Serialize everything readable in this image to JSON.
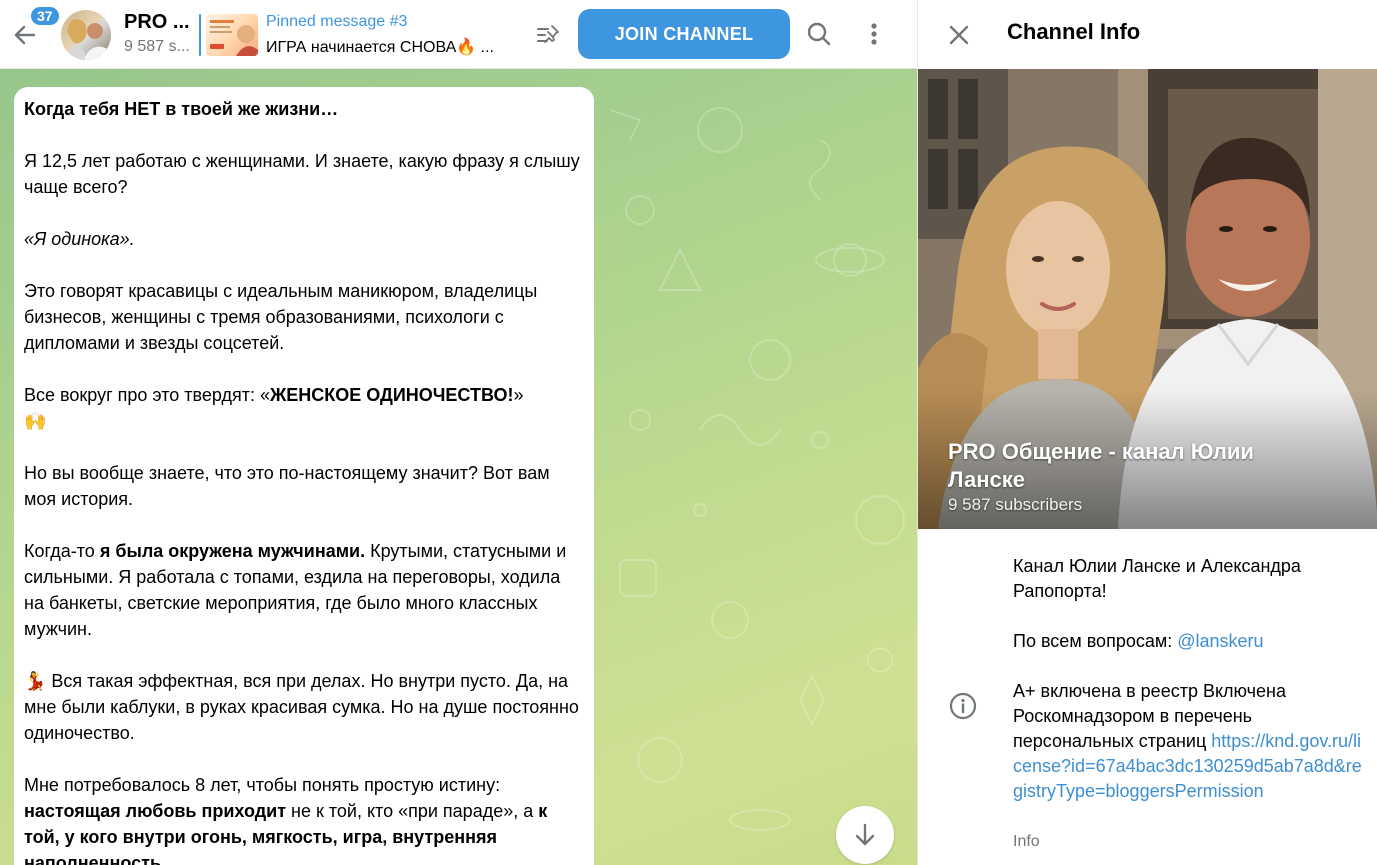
{
  "header": {
    "unread_count": "37",
    "channel_title_short": "PRO ...",
    "subscribers_short": "9 587 s...",
    "pinned_label": "Pinned message #3",
    "pinned_text": "ИГРА начинается СНОВА🔥 ...",
    "join_label": "JOIN CHANNEL"
  },
  "message": {
    "title": "Когда тебя НЕТ в твоей же жизни…",
    "p1": "Я 12,5 лет работаю с женщинами. И знаете, какую фразу я слышу чаще всего?",
    "p2": "«Я одинока».",
    "p3": "Это говорят красавицы с идеальным маникюром, владелицы бизнесов, женщины с тремя образованиями, психологи с дипломами и звезды соцсетей.",
    "p4_a": "Все вокруг про это твердят: «",
    "p4_b": "ЖЕНСКОЕ ОДИНОЧЕСТВО!",
    "p4_c": "»",
    "p4_emoji": "🙌",
    "p5": "Но вы вообще знаете, что это по-настоящему значит? Вот вам моя история.",
    "p6_a": "Когда-то ",
    "p6_b": "я была окружена мужчинами.",
    "p6_c": " Крутыми, статусными и сильными. Я работала с топами, ездила на переговоры, ходила на банкеты, светские мероприятия, где было много классных мужчин.",
    "p7_emoji": "💃",
    "p7": " Вся такая эффектная, вся при делах. Но внутри пусто. Да, на мне были каблуки, в руках красивая сумка. Но на душе постоянно одиночество.",
    "p8_a": "Мне потребовалось 8 лет, чтобы понять простую истину: ",
    "p8_b": "настоящая любовь приходит",
    "p8_c": " не к той, кто «при параде», а ",
    "p8_d": "к той, у кого внутри огонь, мягкость, игра, внутренняя наполненность."
  },
  "info_panel": {
    "title": "Channel Info",
    "channel_name": "PRO Общение - канал Юлии Ланске",
    "subscribers": "9 587 subscribers",
    "description_line1": "Канал Юлии Ланске и Александра Рапопорта!",
    "description_line2_prefix": "По всем вопросам: ",
    "description_line2_link": "@lanskeru",
    "registry_text": "А+ включена в реестр Включена Роскомнадзором в перечень персональных страниц ",
    "registry_link": "https://knd.gov.ru/license?id=67a4bac3dc130259d5ab7a8d&registryType=bloggersPermission",
    "info_caption": "Info"
  },
  "colors": {
    "accent": "#3e96e0",
    "link": "#3e8ed0",
    "chat_bg_top": "#93c48a",
    "chat_bg_bottom": "#cfe092"
  },
  "icons": {
    "back": "arrow-left-icon",
    "pin_list": "pinned-list-icon",
    "search": "search-icon",
    "more": "vertical-dots-icon",
    "close": "close-icon",
    "info": "info-circle-icon",
    "scroll": "arrow-down-icon"
  }
}
